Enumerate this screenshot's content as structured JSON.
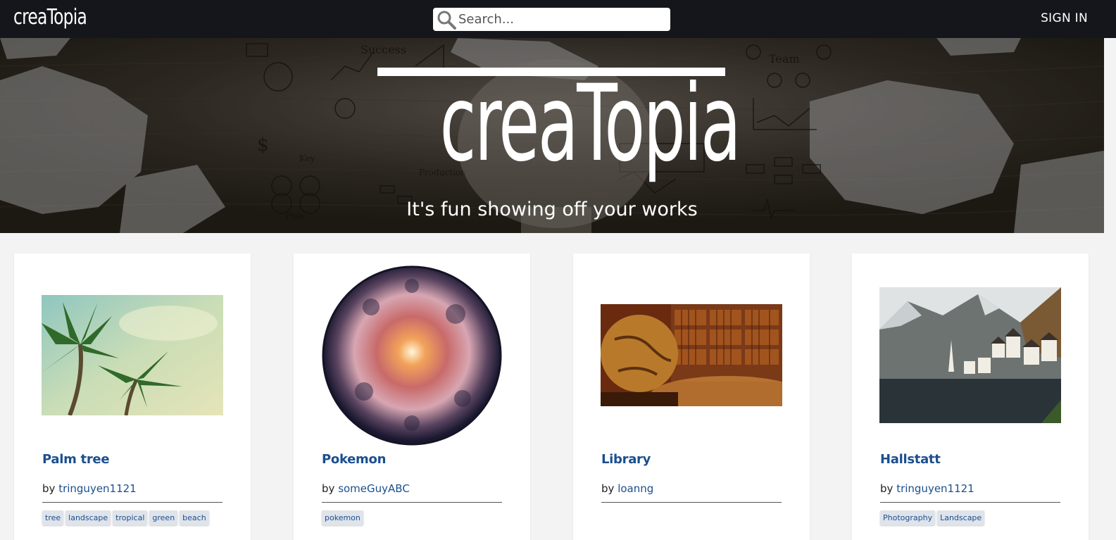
{
  "navbar": {
    "logo": "creaTopia",
    "search_placeholder": "Search...",
    "sign_in": "SIGN IN"
  },
  "hero": {
    "logo": "creaTopia",
    "tagline": "It's fun showing off your works"
  },
  "cards": [
    {
      "title": "Palm tree",
      "by": "by",
      "author": "tringuyen1121",
      "tags": [
        "tree",
        "landscape",
        "tropical",
        "green",
        "beach"
      ]
    },
    {
      "title": "Pokemon",
      "by": "by",
      "author": "someGuyABC",
      "tags": [
        "pokemon"
      ]
    },
    {
      "title": "Library",
      "by": "by",
      "author": "loanng",
      "tags": []
    },
    {
      "title": "Hallstatt",
      "by": "by",
      "author": "tringuyen1121",
      "tags": [
        "Photography",
        "Landscape"
      ]
    }
  ],
  "colors": {
    "navbar": "#14161b",
    "link": "#1b4f8f",
    "page_bg": "#f3f3f3"
  }
}
